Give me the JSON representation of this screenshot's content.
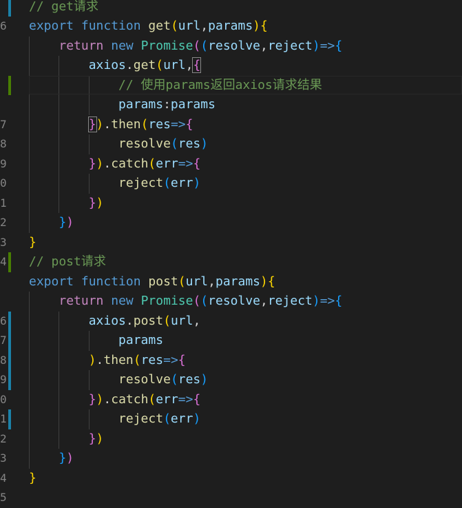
{
  "editor": {
    "language": "javascript",
    "colors": {
      "background": "#1e1e1e",
      "keyword": "#569cd6",
      "control_keyword": "#c586c0",
      "class_name": "#4ec9b0",
      "function_name": "#dcdcaa",
      "variable": "#9cdcfe",
      "comment": "#6a9955",
      "bracket_level_1": "#ffd700",
      "bracket_level_2": "#da70d6",
      "bracket_level_3": "#179fff",
      "git_modified": "#1b81a8",
      "git_added": "#487e02",
      "line_number": "#858585"
    },
    "gutter_digits": [
      "",
      "6",
      "",
      "",
      "",
      "",
      "7",
      "8",
      "9",
      "0",
      "1",
      "2",
      "3",
      "4",
      "",
      "",
      "6",
      "7",
      "8",
      "9",
      "0",
      "1",
      "2",
      "3",
      "4",
      "5"
    ],
    "lines": [
      [
        [
          "cmt",
          "// get请求"
        ]
      ],
      [
        [
          "kw",
          "export"
        ],
        [
          "op",
          " "
        ],
        [
          "kw",
          "function"
        ],
        [
          "op",
          " "
        ],
        [
          "fn",
          "get"
        ],
        [
          "b1",
          "("
        ],
        [
          "var",
          "url"
        ],
        [
          "op",
          ","
        ],
        [
          "var",
          "params"
        ],
        [
          "b1",
          ")"
        ],
        [
          "b1",
          "{"
        ]
      ],
      [
        [
          "op",
          "    "
        ],
        [
          "ctrl",
          "return"
        ],
        [
          "op",
          " "
        ],
        [
          "kw",
          "new"
        ],
        [
          "op",
          " "
        ],
        [
          "cls",
          "Promise"
        ],
        [
          "b2",
          "("
        ],
        [
          "b3",
          "("
        ],
        [
          "var",
          "resolve"
        ],
        [
          "op",
          ","
        ],
        [
          "var",
          "reject"
        ],
        [
          "b3",
          ")"
        ],
        [
          "kw",
          "=>"
        ],
        [
          "b3",
          "{"
        ]
      ],
      [
        [
          "op",
          "        "
        ],
        [
          "var",
          "axios"
        ],
        [
          "op",
          "."
        ],
        [
          "fn",
          "get"
        ],
        [
          "b1",
          "("
        ],
        [
          "var",
          "url"
        ],
        [
          "op",
          ","
        ],
        [
          "b2",
          "{"
        ]
      ],
      [
        [
          "op",
          "            "
        ],
        [
          "cmt",
          "// 使用params返回axios请求结果"
        ]
      ],
      [
        [
          "op",
          "            "
        ],
        [
          "var",
          "params"
        ],
        [
          "op",
          ":"
        ],
        [
          "var",
          "params"
        ]
      ],
      [
        [
          "op",
          "        "
        ],
        [
          "b2",
          "}"
        ],
        [
          "b1",
          ")"
        ],
        [
          "op",
          "."
        ],
        [
          "fn",
          "then"
        ],
        [
          "b1",
          "("
        ],
        [
          "var",
          "res"
        ],
        [
          "kw",
          "=>"
        ],
        [
          "b2",
          "{"
        ]
      ],
      [
        [
          "op",
          "            "
        ],
        [
          "fn",
          "resolve"
        ],
        [
          "b3",
          "("
        ],
        [
          "var",
          "res"
        ],
        [
          "b3",
          ")"
        ]
      ],
      [
        [
          "op",
          "        "
        ],
        [
          "b2",
          "}"
        ],
        [
          "b1",
          ")"
        ],
        [
          "op",
          "."
        ],
        [
          "fn",
          "catch"
        ],
        [
          "b1",
          "("
        ],
        [
          "var",
          "err"
        ],
        [
          "kw",
          "=>"
        ],
        [
          "b2",
          "{"
        ]
      ],
      [
        [
          "op",
          "            "
        ],
        [
          "fn",
          "reject"
        ],
        [
          "b3",
          "("
        ],
        [
          "var",
          "err"
        ],
        [
          "b3",
          ")"
        ]
      ],
      [
        [
          "op",
          "        "
        ],
        [
          "b2",
          "}"
        ],
        [
          "b1",
          ")"
        ]
      ],
      [
        [
          "op",
          "    "
        ],
        [
          "b3",
          "}"
        ],
        [
          "b2",
          ")"
        ]
      ],
      [
        [
          "b1",
          "}"
        ]
      ],
      [
        [
          "cmt",
          "// post请求"
        ]
      ],
      [
        [
          "kw",
          "export"
        ],
        [
          "op",
          " "
        ],
        [
          "kw",
          "function"
        ],
        [
          "op",
          " "
        ],
        [
          "fn",
          "post"
        ],
        [
          "b1",
          "("
        ],
        [
          "var",
          "url"
        ],
        [
          "op",
          ","
        ],
        [
          "var",
          "params"
        ],
        [
          "b1",
          ")"
        ],
        [
          "b1",
          "{"
        ]
      ],
      [
        [
          "op",
          "    "
        ],
        [
          "ctrl",
          "return"
        ],
        [
          "op",
          " "
        ],
        [
          "kw",
          "new"
        ],
        [
          "op",
          " "
        ],
        [
          "cls",
          "Promise"
        ],
        [
          "b2",
          "("
        ],
        [
          "b3",
          "("
        ],
        [
          "var",
          "resolve"
        ],
        [
          "op",
          ","
        ],
        [
          "var",
          "reject"
        ],
        [
          "b3",
          ")"
        ],
        [
          "kw",
          "=>"
        ],
        [
          "b3",
          "{"
        ]
      ],
      [
        [
          "op",
          "        "
        ],
        [
          "var",
          "axios"
        ],
        [
          "op",
          "."
        ],
        [
          "fn",
          "post"
        ],
        [
          "b1",
          "("
        ],
        [
          "var",
          "url"
        ],
        [
          "op",
          ","
        ]
      ],
      [
        [
          "op",
          "            "
        ],
        [
          "var",
          "params"
        ]
      ],
      [
        [
          "op",
          "        "
        ],
        [
          "b1",
          ")"
        ],
        [
          "op",
          "."
        ],
        [
          "fn",
          "then"
        ],
        [
          "b1",
          "("
        ],
        [
          "var",
          "res"
        ],
        [
          "kw",
          "=>"
        ],
        [
          "b2",
          "{"
        ]
      ],
      [
        [
          "op",
          "            "
        ],
        [
          "fn",
          "resolve"
        ],
        [
          "b3",
          "("
        ],
        [
          "var",
          "res"
        ],
        [
          "b3",
          ")"
        ]
      ],
      [
        [
          "op",
          "        "
        ],
        [
          "b2",
          "}"
        ],
        [
          "b1",
          ")"
        ],
        [
          "op",
          "."
        ],
        [
          "fn",
          "catch"
        ],
        [
          "b1",
          "("
        ],
        [
          "var",
          "err"
        ],
        [
          "kw",
          "=>"
        ],
        [
          "b2",
          "{"
        ]
      ],
      [
        [
          "op",
          "            "
        ],
        [
          "fn",
          "reject"
        ],
        [
          "b3",
          "("
        ],
        [
          "var",
          "err"
        ],
        [
          "b3",
          ")"
        ]
      ],
      [
        [
          "op",
          "        "
        ],
        [
          "b2",
          "}"
        ],
        [
          "b1",
          ")"
        ]
      ],
      [
        [
          "op",
          "    "
        ],
        [
          "b3",
          "}"
        ],
        [
          "b2",
          ")"
        ]
      ],
      [
        [
          "b1",
          "}"
        ]
      ]
    ]
  }
}
